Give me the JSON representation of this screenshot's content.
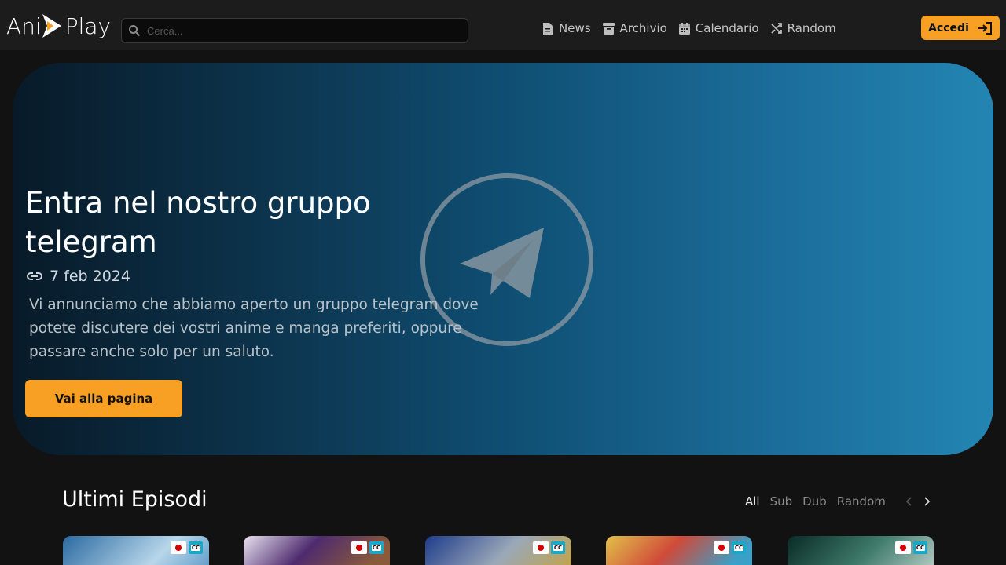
{
  "header": {
    "logo_left": "Ani",
    "logo_right": "Play",
    "search_placeholder": "Cerca...",
    "nav": [
      {
        "label": "News",
        "icon": "document-icon"
      },
      {
        "label": "Archivio",
        "icon": "archive-icon"
      },
      {
        "label": "Calendario",
        "icon": "calendar-icon"
      },
      {
        "label": "Random",
        "icon": "shuffle-icon"
      }
    ],
    "login_label": "Accedi"
  },
  "hero": {
    "title": "Entra nel nostro gruppo telegram",
    "date": "7 feb 2024",
    "description": "Vi annunciamo che abbiamo aperto un gruppo telegram dove potete discutere dei vostri anime e manga preferiti, oppure passare anche solo per un saluto.",
    "cta_label": "Vai alla pagina"
  },
  "episodes": {
    "title": "Ultimi Episodi",
    "filters": [
      "All",
      "Sub",
      "Dub",
      "Random"
    ],
    "active_filter": "All"
  },
  "colors": {
    "accent": "#f7a023",
    "header_bg": "#1c1c1c",
    "page_bg": "#121212",
    "cc_badge": "#1aa8c8"
  }
}
